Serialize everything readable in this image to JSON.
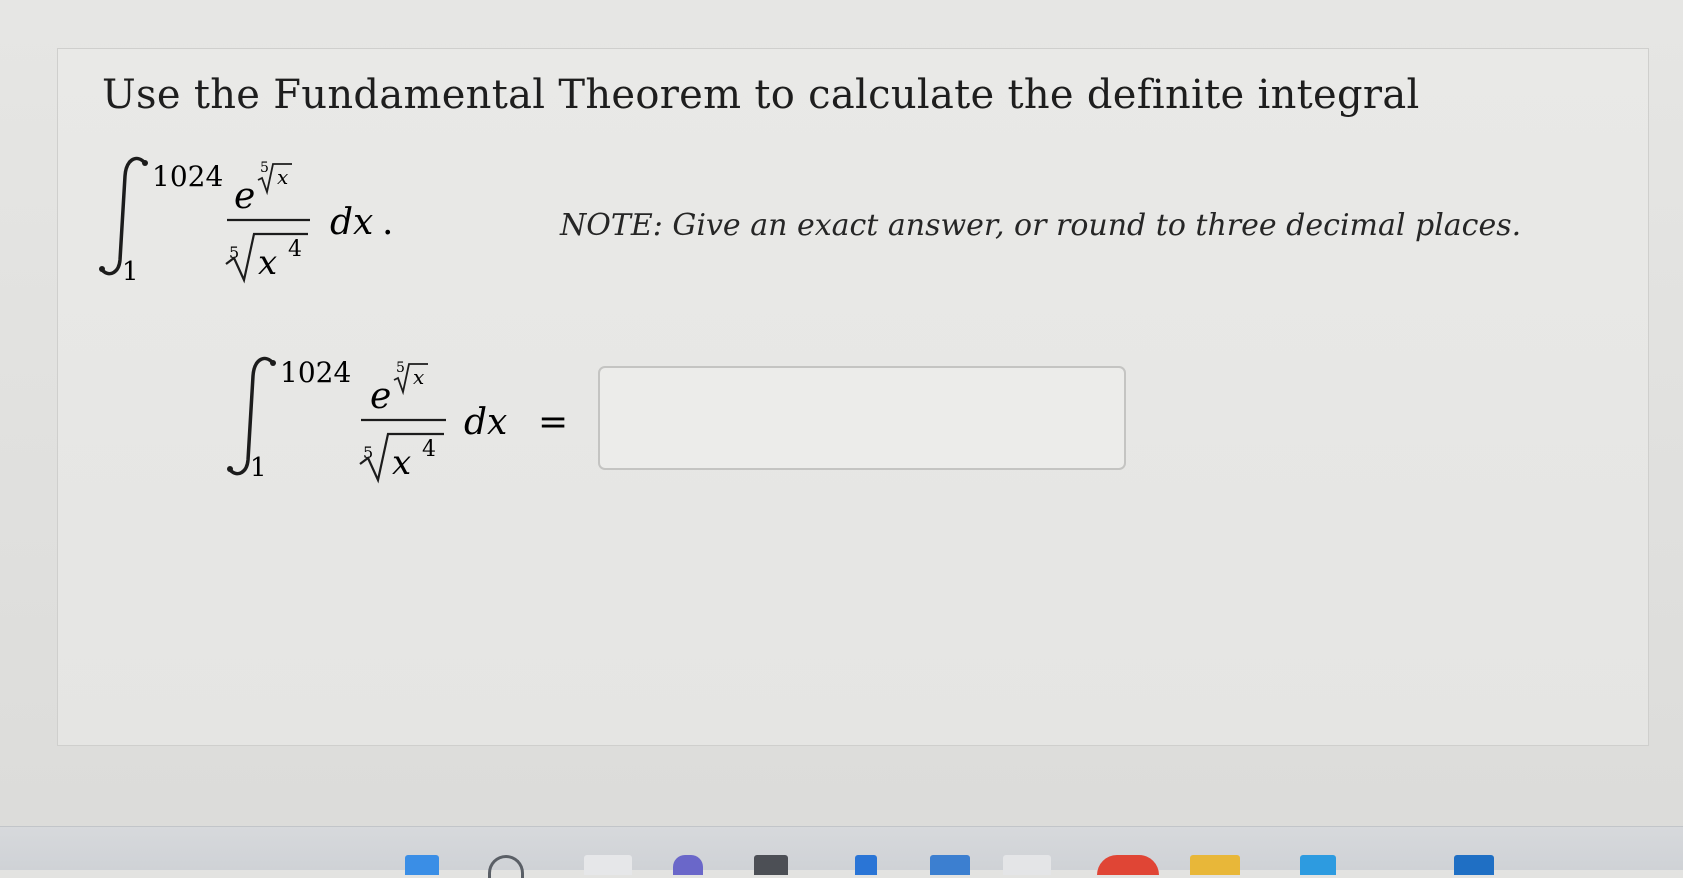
{
  "question": {
    "prompt": "Use the Fundamental Theorem to calculate the definite integral",
    "note": "NOTE: Give an exact answer, or round to three decimal places."
  },
  "integral_display": {
    "upper_limit": "1024",
    "lower_limit": "1",
    "base": "e",
    "radical_index": "5",
    "radicand_exponent_var": "x",
    "denominator_var": "x",
    "denominator_power": "4",
    "differential": "dx",
    "trailing_punctuation": "."
  },
  "answer_row": {
    "upper_limit": "1024",
    "lower_limit": "1",
    "base": "e",
    "radical_index": "5",
    "radicand_exponent_var": "x",
    "denominator_var": "x",
    "denominator_power": "4",
    "differential": "dx",
    "equals": "="
  },
  "answer_field": {
    "value": "",
    "placeholder": ""
  }
}
